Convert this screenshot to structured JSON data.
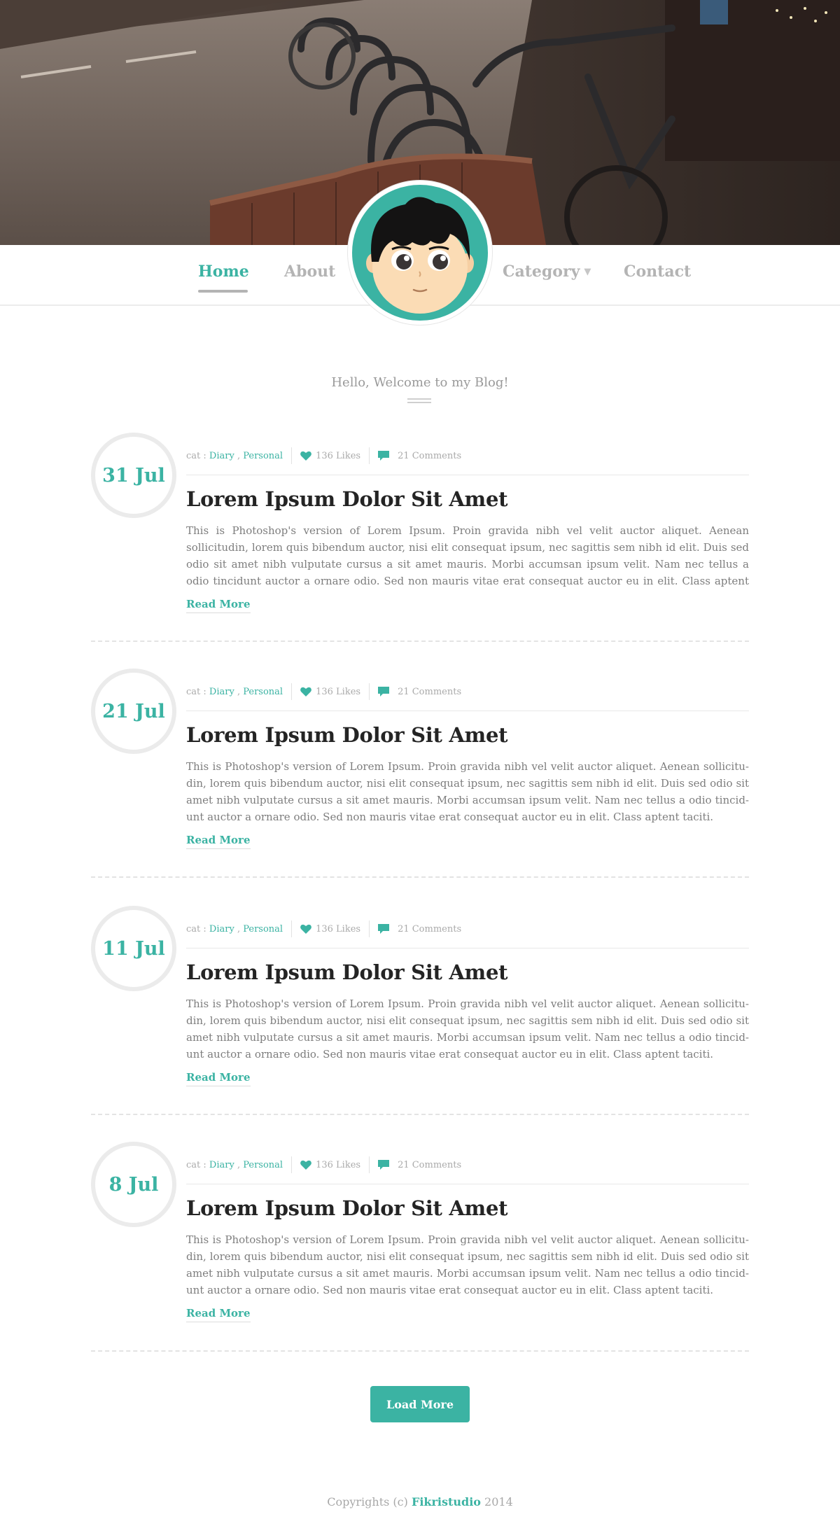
{
  "colors": {
    "accent": "#3bb3a3",
    "text": "#7d7d7d",
    "title": "#242424",
    "muted": "#b4b4b4"
  },
  "hero": {
    "image": "street-bicycles-photo"
  },
  "nav": {
    "items": [
      {
        "label": "Home",
        "active": true
      },
      {
        "label": "About",
        "active": false
      },
      {
        "label": "Category",
        "active": false,
        "dropdown": true
      },
      {
        "label": "Contact",
        "active": false
      }
    ],
    "caret_icon": "chevron-down-icon",
    "avatar": "cartoon-boy-avatar"
  },
  "welcome": "Hello, Welcome to my Blog!",
  "posts": [
    {
      "date": "31 Jul",
      "cat_prefix": "cat :",
      "categories": [
        "Diary",
        "Personal"
      ],
      "likes": "136 Likes",
      "comments": "21 Comments",
      "title": "Lorem Ipsum Dolor Sit Amet",
      "body": "This is Photoshop's version  of Lorem Ipsum. Proin gravida nibh vel velit auctor aliquet. Aenean sollicitudin, lorem quis bibendum auctor, nisi elit consequat ipsum, nec sagittis sem nibh id elit. Duis sed odio sit amet nibh vulputate cursus a sit amet mauris. Morbi accumsan ipsum velit. Nam nec tellus a odio tincidunt auctor a ornare odio. Sed non mauris vitae erat consequat auctor eu in elit. Class aptent taciti. sociosqu ad litora torquent per conubia nostra, per",
      "read_more": "Read More"
    },
    {
      "date": "21 Jul",
      "cat_prefix": "cat :",
      "categories": [
        "Diary",
        "Personal"
      ],
      "likes": "136 Likes",
      "comments": "21 Comments",
      "title": "Lorem Ipsum Dolor Sit Amet",
      "body": "This is Photoshop's version  of Lorem Ipsum. Proin gravida nibh vel velit auctor aliquet. Aenean sollicitu-din, lorem quis bibendum auctor, nisi elit consequat ipsum, nec sagittis sem nibh id elit. Duis sed odio sit amet nibh vulputate cursus a sit amet mauris. Morbi accumsan ipsum velit. Nam nec tellus a odio tincid-unt auctor a ornare odio. Sed non  mauris vitae erat consequat auctor eu in elit. Class aptent taciti.",
      "read_more": "Read More"
    },
    {
      "date": "11 Jul",
      "cat_prefix": "cat :",
      "categories": [
        "Diary",
        "Personal"
      ],
      "likes": "136 Likes",
      "comments": "21 Comments",
      "title": "Lorem Ipsum Dolor Sit Amet",
      "body": "This is Photoshop's version  of Lorem Ipsum. Proin gravida nibh vel velit auctor aliquet. Aenean sollicitu-din, lorem quis bibendum auctor, nisi elit consequat ipsum, nec sagittis sem nibh id elit. Duis sed odio sit amet nibh vulputate cursus a sit amet mauris. Morbi accumsan ipsum velit. Nam nec tellus a odio tincid-unt auctor a ornare odio. Sed non  mauris vitae erat consequat auctor eu in elit. Class aptent taciti.",
      "read_more": "Read More"
    },
    {
      "date": "8 Jul",
      "cat_prefix": "cat :",
      "categories": [
        "Diary",
        "Personal"
      ],
      "likes": "136 Likes",
      "comments": "21 Comments",
      "title": "Lorem Ipsum Dolor Sit Amet",
      "body": "This is Photoshop's version  of Lorem Ipsum. Proin gravida nibh vel velit auctor aliquet. Aenean sollicitu-din, lorem quis bibendum auctor, nisi elit consequat ipsum, nec sagittis sem nibh id elit. Duis sed odio sit amet nibh vulputate cursus a sit amet mauris. Morbi accumsan ipsum velit. Nam nec tellus a odio tincid-unt auctor a ornare odio. Sed non  mauris vitae erat consequat auctor eu in elit. Class aptent taciti.",
      "read_more": "Read More"
    }
  ],
  "load_more": "Load More",
  "footer": {
    "prefix": "Copyrights (c)",
    "brand": "Fikristudio",
    "year": "2014"
  },
  "icons": {
    "like": "heart-icon",
    "comment": "comment-icon"
  }
}
